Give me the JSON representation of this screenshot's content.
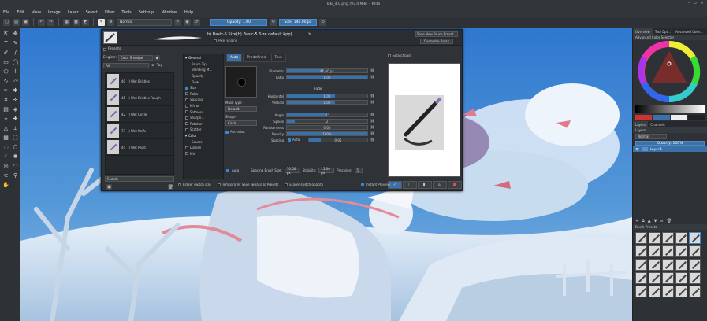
{
  "window": {
    "title": "kiki_4.0.png (93.4 MiB) – Krita"
  },
  "menu": [
    "File",
    "Edit",
    "View",
    "Image",
    "Layer",
    "Select",
    "Filter",
    "Tools",
    "Settings",
    "Window",
    "Help"
  ],
  "toolbar": {
    "blend_mode": "Normal",
    "opacity_label": "Opacity: 1.00",
    "size_label": "Size: 140.00 px"
  },
  "dialog": {
    "preset_name": "b) Basic-5 Size(b) Basic-5 Size default.kpp)",
    "engine_label": "Pixel Engine",
    "save_new_button": "Save New Brush Preset...",
    "overwrite_button": "Overwrite Brush",
    "presets": {
      "header": "Presets",
      "engine_label": "Engine:",
      "engine_value": "Color Smudge",
      "filter_value": "All",
      "tag_label": "Tag",
      "items": [
        {
          "num": "40",
          "name": "i) Wet Bristles"
        },
        {
          "num": "41",
          "name": "i) Wet Bristles Rough"
        },
        {
          "num": "42",
          "name": "i) Wet Circle"
        },
        {
          "num": "73",
          "name": "i) Wet Knife"
        },
        {
          "num": "44",
          "name": "j) Wet Paint"
        }
      ],
      "search_placeholder": "Search"
    },
    "options": [
      {
        "label": "General",
        "header": true
      },
      {
        "label": "Brush Tip",
        "check": false,
        "nocheck": true
      },
      {
        "label": "Blending M...",
        "check": false,
        "nocheck": true
      },
      {
        "label": "Opacity",
        "check": false,
        "nocheck": true
      },
      {
        "label": "Flow",
        "check": false,
        "nocheck": true
      },
      {
        "label": "Size",
        "check": true
      },
      {
        "label": "Ratio",
        "check": false
      },
      {
        "label": "Spacing",
        "check": false
      },
      {
        "label": "Mirror",
        "check": false
      },
      {
        "label": "Softness",
        "check": false
      },
      {
        "label": "Sharpn...",
        "check": false
      },
      {
        "label": "Rotation",
        "check": false
      },
      {
        "label": "Scatter",
        "check": false
      },
      {
        "label": "Color",
        "header": true
      },
      {
        "label": "Source",
        "check": false,
        "nocheck": true
      },
      {
        "label": "Darken",
        "check": false
      },
      {
        "label": "Mix",
        "check": false
      }
    ],
    "tabs": [
      "Auto",
      "Predefined",
      "Text"
    ],
    "tip": {
      "mask_type_label": "Mask Type",
      "mask_type": "Default",
      "shape_label": "Shape",
      "shape": "Circle",
      "antialias_label": "Anti-alias",
      "params": [
        {
          "label": "Diameter",
          "value": "40.00 px",
          "fill": 0.45
        },
        {
          "label": "Ratio",
          "value": "1.00",
          "fill": 1.0
        },
        {
          "label": "Horizontal",
          "value": "1.00",
          "fill": 0.6
        },
        {
          "label": "Vertical",
          "value": "1.00",
          "fill": 0.6
        },
        {
          "label": "Angle",
          "value": "0°",
          "fill": 0.5
        },
        {
          "label": "Spikes",
          "value": "2",
          "fill": 0.1
        },
        {
          "label": "Randomness",
          "value": "0.00",
          "fill": 0.0
        },
        {
          "label": "Density",
          "value": "100%",
          "fill": 1.0
        },
        {
          "label": "Spacing",
          "value": "0.05",
          "fill": 0.2
        }
      ],
      "fade_label": "Fade",
      "spacing_auto": "Auto",
      "footer": {
        "auto": "Auto",
        "spacing_brush_size_label": "Spacing Brush Size:",
        "spacing_brush_size": "10.00 px",
        "stability_label": "Stability:",
        "stability": "15.00 px",
        "precision_label": "Precision:",
        "precision": "5"
      }
    },
    "scratchpad_label": "Scratchpad",
    "bottom_options": [
      {
        "label": "Eraser switch size",
        "on": false
      },
      {
        "label": "Temporarily Save Tweaks To Presets",
        "on": false
      },
      {
        "label": "Eraser switch opacity",
        "on": false
      },
      {
        "label": "Instant Preview",
        "on": true
      }
    ]
  },
  "right_dock": {
    "tabs_top": [
      "Overview",
      "Tool Opt...",
      "Advanced Color..."
    ],
    "color_selector_title": "Advanced Color Selector",
    "tabs_mid": [
      "Layers",
      "Channels"
    ],
    "layers_title": "Layers",
    "layer_blend": "Normal",
    "layer_opacity": "Opacity: 100%",
    "layers": [
      {
        "name": "Layer 1",
        "selected": true
      }
    ],
    "brush_presets_title": "Brush Presets"
  },
  "colors": {
    "accent": "#3a71a8",
    "canvas_sky": "#3d7ec9",
    "panel_bg": "#2f3337"
  }
}
